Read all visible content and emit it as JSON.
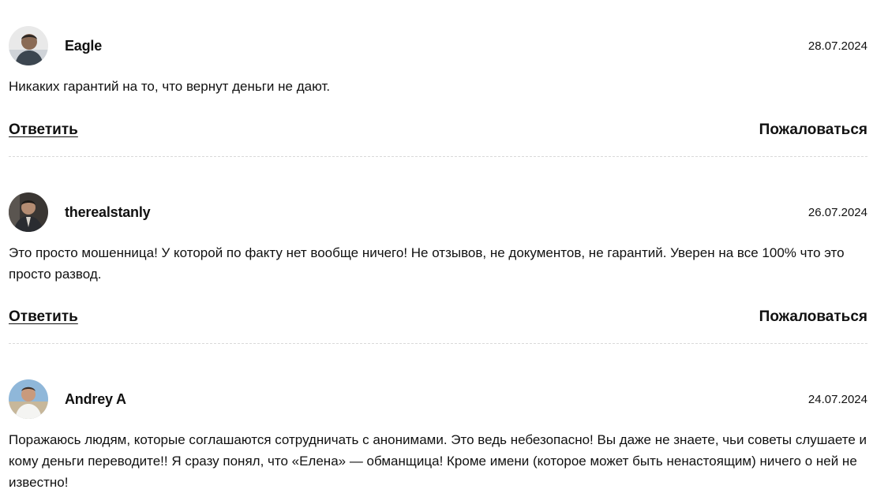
{
  "comments": [
    {
      "author": "Eagle",
      "date": "28.07.2024",
      "text": "Никаких гарантий на то, что вернут деньги не дают.",
      "reply_label": "Ответить",
      "report_label": "Пожаловаться"
    },
    {
      "author": "therealstanly",
      "date": "26.07.2024",
      "text": "Это просто мошенница! У которой по факту нет вообще ничего! Не отзывов, не документов, не гарантий. Уверен на все 100% что это просто развод.",
      "reply_label": "Ответить",
      "report_label": "Пожаловаться"
    },
    {
      "author": "Andrey A",
      "date": "24.07.2024",
      "text": "Поражаюсь людям, которые соглашаются сотрудничать с анонимами. Это ведь небезопасно! Вы даже не знаете, чьи советы слушаете и кому деньги переводите!! Я сразу понял, что «Елена» — обманщица! Кроме имени (которое может быть ненастоящим) ничего о ней не известно!"
    }
  ]
}
